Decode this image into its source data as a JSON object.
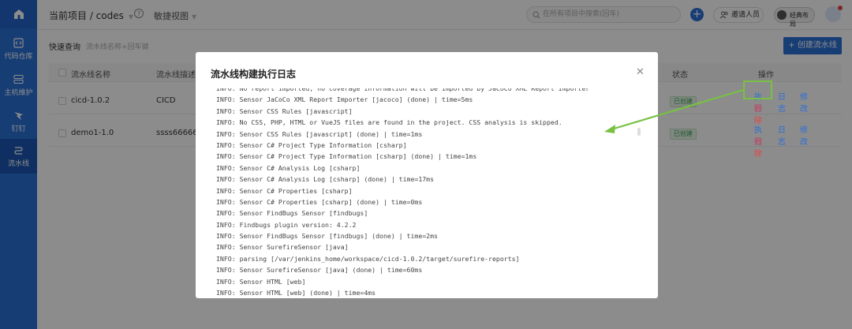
{
  "sidebar": {
    "items": [
      {
        "label": "代码仓库",
        "icon": "code-icon"
      },
      {
        "label": "主机维护",
        "icon": "server-icon"
      },
      {
        "label": "钉钉",
        "icon": "dingtalk-icon"
      },
      {
        "label": "流水线",
        "icon": "pipeline-icon"
      }
    ]
  },
  "header": {
    "breadcrumb": "当前项目 / codes",
    "view_label": "敏捷视图",
    "search_placeholder": "在所有项目中搜索(回车)",
    "invite_label": "邀请人员",
    "toggle_label": "经典布局"
  },
  "toolbar": {
    "quick_search_label": "快速查询",
    "quick_search_hint": "流水线名称+回车键",
    "create_label": "+ 创建流水线"
  },
  "table": {
    "headers": [
      "流水线名称",
      "流水线描述",
      "状态",
      "操作"
    ],
    "rows": [
      {
        "name": "cicd-1.0.2",
        "desc": "CICD",
        "status": "已创建",
        "actions": [
          "执行",
          "日志",
          "修改",
          "删除"
        ]
      },
      {
        "name": "demo1-1.0",
        "desc": "ssss666666",
        "status": "已创建",
        "actions": [
          "执行",
          "日志",
          "修改",
          "删除"
        ]
      }
    ]
  },
  "modal": {
    "title": "流水线构建执行日志",
    "log_lines": [
      "INFO: No report imported, no coverage information will be imported by JaCoCo XML Report Importer",
      "INFO: Sensor JaCoCo XML Report Importer [jacoco] (done) | time=5ms",
      "INFO: Sensor CSS Rules [javascript]",
      "INFO: No CSS, PHP, HTML or VueJS files are found in the project. CSS analysis is skipped.",
      "INFO: Sensor CSS Rules [javascript] (done) | time=1ms",
      "INFO: Sensor C# Project Type Information [csharp]",
      "INFO: Sensor C# Project Type Information [csharp] (done) | time=1ms",
      "INFO: Sensor C# Analysis Log [csharp]",
      "INFO: Sensor C# Analysis Log [csharp] (done) | time=17ms",
      "INFO: Sensor C# Properties [csharp]",
      "INFO: Sensor C# Properties [csharp] (done) | time=0ms",
      "INFO: Sensor FindBugs Sensor [findbugs]",
      "INFO: Findbugs plugin version: 4.2.2",
      "INFO: Sensor FindBugs Sensor [findbugs] (done) | time=2ms",
      "INFO: Sensor SurefireSensor [java]",
      "INFO: parsing [/var/jenkins_home/workspace/cicd-1.0.2/target/surefire-reports]",
      "INFO: Sensor SurefireSensor [java] (done) | time=60ms",
      "INFO: Sensor HTML [web]",
      "INFO: Sensor HTML [web] (done) | time=4ms"
    ]
  },
  "colors": {
    "brand": "#2a6fd6",
    "danger": "#e54545",
    "success": "#3aa353",
    "highlight": "#78c043"
  }
}
